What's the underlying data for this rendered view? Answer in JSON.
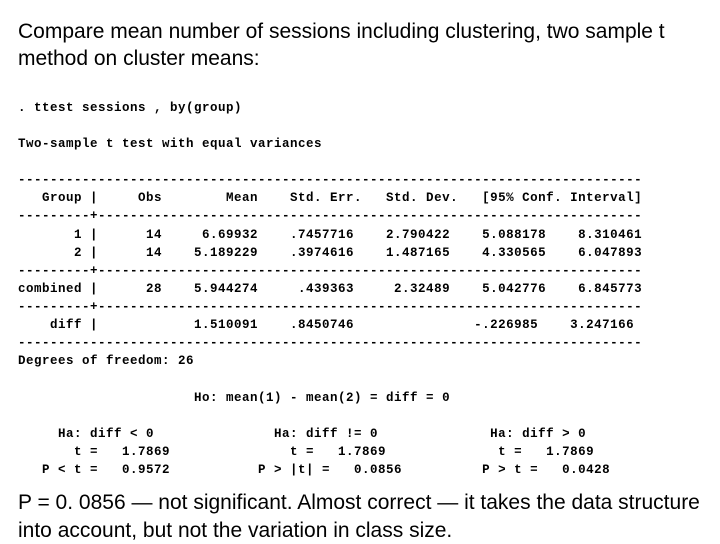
{
  "title": "Compare mean number of sessions including clustering, two sample t method on cluster means:",
  "command": ". ttest sessions , by(group)",
  "heading": "Two-sample t test with equal variances",
  "rules": {
    "full": "------------------------------------------------------------------------------",
    "cross": "---------+--------------------------------------------------------------------"
  },
  "header": "   Group |     Obs        Mean    Std. Err.   Std. Dev.   [95% Conf. Interval]",
  "rows": [
    "       1 |      14     6.69932    .7457716    2.790422    5.088178    8.310461",
    "       2 |      14    5.189229    .3974616    1.487165    4.330565    6.047893",
    "combined |      28    5.944274     .439363     2.32489    5.042776    6.845773",
    "    diff |            1.510091    .8450746               -.226985    3.247166"
  ],
  "df": "Degrees of freedom: 26",
  "ho": "                      Ho: mean(1) - mean(2) = diff = 0",
  "ha_row": "     Ha: diff < 0               Ha: diff != 0              Ha: diff > 0",
  "t_row": "       t =   1.7869               t =   1.7869              t =   1.7869",
  "p_row": "   P < t =   0.9572           P > |t| =   0.0856          P > t =   0.0428",
  "conclusion": "P = 0. 0856 — not significant.  Almost correct — it takes the data structure into account, but not the variation in class size.",
  "chart_data": {
    "type": "table",
    "title": "Two-sample t test with equal variances",
    "columns": [
      "Group",
      "Obs",
      "Mean",
      "Std. Err.",
      "Std. Dev.",
      "95% Conf. Low",
      "95% Conf. High"
    ],
    "rows": [
      {
        "Group": "1",
        "Obs": 14,
        "Mean": 6.69932,
        "Std. Err.": 0.7457716,
        "Std. Dev.": 2.790422,
        "95% Conf. Low": 5.088178,
        "95% Conf. High": 8.310461
      },
      {
        "Group": "2",
        "Obs": 14,
        "Mean": 5.189229,
        "Std. Err.": 0.3974616,
        "Std. Dev.": 1.487165,
        "95% Conf. Low": 4.330565,
        "95% Conf. High": 6.047893
      },
      {
        "Group": "combined",
        "Obs": 28,
        "Mean": 5.944274,
        "Std. Err.": 0.439363,
        "Std. Dev.": 2.32489,
        "95% Conf. Low": 5.042776,
        "95% Conf. High": 6.845773
      },
      {
        "Group": "diff",
        "Obs": null,
        "Mean": 1.510091,
        "Std. Err.": 0.8450746,
        "Std. Dev.": null,
        "95% Conf. Low": -0.226985,
        "95% Conf. High": 3.247166
      }
    ],
    "degrees_of_freedom": 26,
    "null_hypothesis": "mean(1) - mean(2) = diff = 0",
    "alternatives": [
      {
        "Ha": "diff < 0",
        "t": 1.7869,
        "p": 0.9572,
        "p_label": "P < t"
      },
      {
        "Ha": "diff != 0",
        "t": 1.7869,
        "p": 0.0856,
        "p_label": "P > |t|"
      },
      {
        "Ha": "diff > 0",
        "t": 1.7869,
        "p": 0.0428,
        "p_label": "P > t"
      }
    ]
  }
}
